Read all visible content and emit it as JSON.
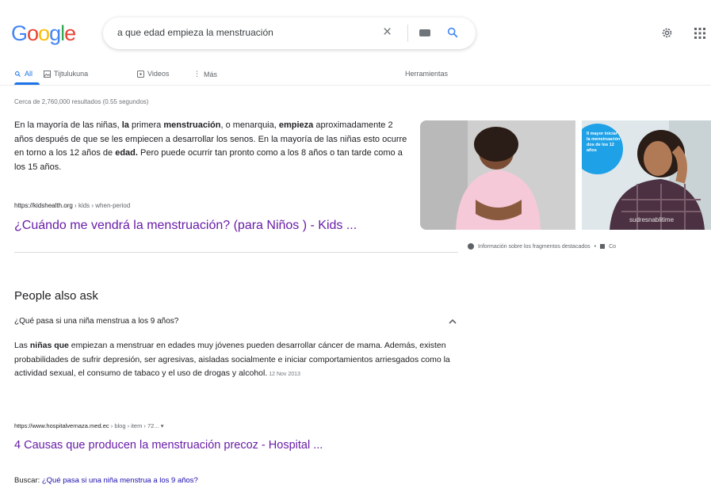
{
  "header": {
    "logo_letters": [
      {
        "ch": "G",
        "color": "#4285F4"
      },
      {
        "ch": "o",
        "color": "#EA4335"
      },
      {
        "ch": "o",
        "color": "#FBBC05"
      },
      {
        "ch": "g",
        "color": "#4285F4"
      },
      {
        "ch": "l",
        "color": "#34A853"
      },
      {
        "ch": "e",
        "color": "#EA4335"
      }
    ],
    "search_query": "a que edad empieza la menstruación",
    "clear_icon": "close-icon",
    "keyboard_icon": "keyboard-icon",
    "search_icon": "search-icon",
    "settings_icon": "gear-icon",
    "apps_icon": "apps-grid-icon"
  },
  "tabs": {
    "all": "All",
    "images": "Tijtulukuna",
    "videos": "Videos",
    "more": "Más",
    "tools": "Herramientas"
  },
  "result_stats": "Cerca de 2,760,000 resultados (0.55 segundos)",
  "snippet": {
    "segments": [
      {
        "t": "En la mayoría de las niñas, ",
        "b": false
      },
      {
        "t": "la",
        "b": true
      },
      {
        "t": " primera ",
        "b": false
      },
      {
        "t": "menstruación",
        "b": true
      },
      {
        "t": ", o menarquia, ",
        "b": false
      },
      {
        "t": "empieza",
        "b": true
      },
      {
        "t": " aproximadamente 2 años después de que se les empiecen a desarrollar los senos. En la mayoría de las niñas esto ocurre en torno a los 12 años de ",
        "b": false
      },
      {
        "t": "edad.",
        "b": true
      },
      {
        "t": " Pero puede ocurrir tan pronto como a los 8 años o tan tarde como a los 15 años.",
        "b": false
      }
    ],
    "cite_domain": "https://kidshealth.org",
    "cite_path": " › kids › when-period",
    "link_title": "¿Cuándo me vendrá la menstruación? (para Niños ) - Kids ...",
    "image_badge_text": "Il mayor iniciar la menstruación dos de los 12 años",
    "image_watermark": "sudresnablitime",
    "about_text": "Información sobre los fragmentos destacados",
    "about_sep": "•",
    "feedback_text": "Co"
  },
  "paa": {
    "title": "People also ask",
    "question": "¿Qué pasa si una niña menstrua a los 9 años?",
    "answer_segments": [
      {
        "t": "Las ",
        "b": false
      },
      {
        "t": "niñas que",
        "b": true
      },
      {
        "t": " empiezan a menstruar en edades muy jóvenes pueden desarrollar cáncer de mama. Además, existen probabilidades de sufrir depresión, ser agresivas, aisladas socialmente e iniciar comportamientos arriesgados como la actividad sexual, el consumo de tabaco y el uso de drogas y alcohol.",
        "b": false
      }
    ],
    "date": "12 Nov 2013",
    "cite_domain": "https://www.hospitalvernaza.med.ec",
    "cite_path": " › blog › item › 72...",
    "cite_menu": "▾",
    "link_title": "4 Causas que producen la menstruación precoz - Hospital ...",
    "buscar_label": "Buscar: ",
    "buscar_query": "¿Qué pasa si una niña menstrua a los 9 años?"
  }
}
